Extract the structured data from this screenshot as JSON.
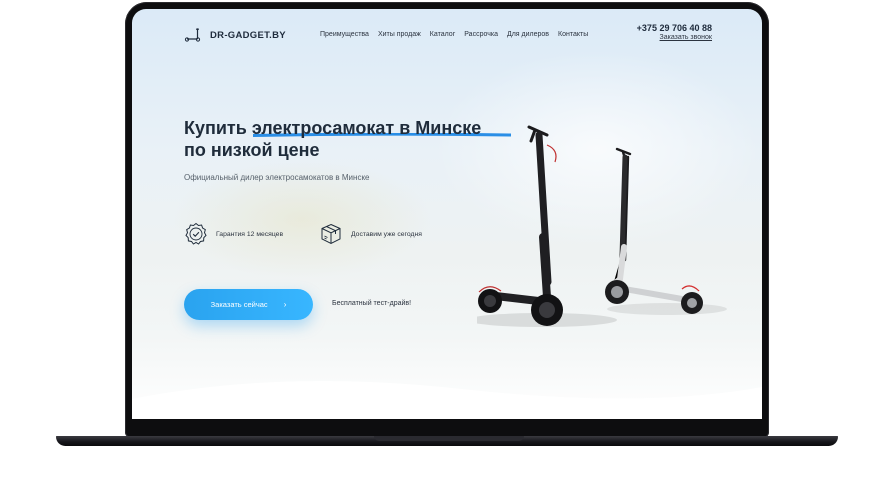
{
  "header": {
    "logo_text": "DR-GADGET.BY",
    "nav": [
      "Преимущества",
      "Хиты продаж",
      "Каталог",
      "Рассрочка",
      "Для дилеров",
      "Контакты"
    ],
    "phone": "+375 29 706 40 88",
    "callback_link": "Заказать звонок"
  },
  "hero": {
    "title_line1": "Купить электросамокат в Минске",
    "title_line2": "по низкой цене",
    "subtitle": "Официальный дилер электросамокатов в Минске",
    "features": [
      {
        "icon": "badge-check-icon",
        "label": "Гарантия 12 месяцев"
      },
      {
        "icon": "box-icon",
        "label": "Доставим уже сегодня"
      }
    ],
    "cta_label": "Заказать сейчас",
    "cta_arrow": "›",
    "test_drive": "Бесплатный тест-драйв!"
  },
  "colors": {
    "accent": "#2aa3ef",
    "title": "#1f2c3b",
    "underline": "#2a8ee6"
  }
}
